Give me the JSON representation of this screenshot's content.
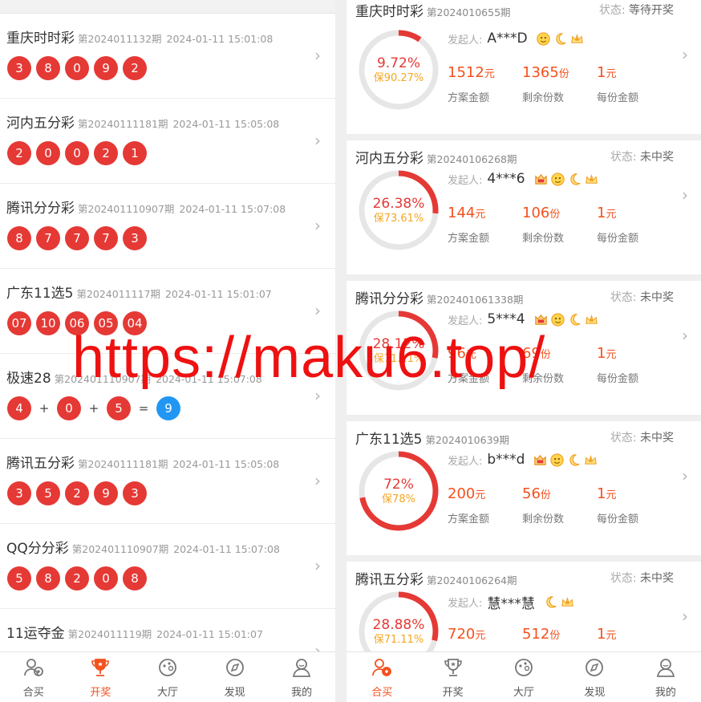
{
  "left": {
    "draws": [
      {
        "name": "重庆时时彩",
        "issue": "第2024011132期",
        "time": "2024-01-11 15:01:08",
        "balls": [
          "3",
          "8",
          "0",
          "9",
          "2"
        ]
      },
      {
        "name": "河内五分彩",
        "issue": "第20240111181期",
        "time": "2024-01-11 15:05:08",
        "balls": [
          "2",
          "0",
          "0",
          "2",
          "1"
        ]
      },
      {
        "name": "腾讯分分彩",
        "issue": "第202401110907期",
        "time": "2024-01-11 15:07:08",
        "balls": [
          "8",
          "7",
          "7",
          "7",
          "3"
        ]
      },
      {
        "name": "广东11选5",
        "issue": "第2024011117期",
        "time": "2024-01-11 15:01:07",
        "balls": [
          "07",
          "10",
          "06",
          "05",
          "04"
        ]
      },
      {
        "name": "极速28",
        "issue": "第202401110907期",
        "time": "2024-01-11 15:07:08",
        "sum": {
          "a": "4",
          "b": "0",
          "c": "5",
          "result": "9",
          "plus": "+",
          "equals": "="
        }
      },
      {
        "name": "腾讯五分彩",
        "issue": "第20240111181期",
        "time": "2024-01-11 15:05:08",
        "balls": [
          "3",
          "5",
          "2",
          "9",
          "3"
        ]
      },
      {
        "name": "QQ分分彩",
        "issue": "第202401110907期",
        "time": "2024-01-11 15:07:08",
        "balls": [
          "5",
          "8",
          "2",
          "0",
          "8"
        ]
      },
      {
        "name": "11运夺金",
        "issue": "第2024011119期",
        "time": "2024-01-11 15:01:07",
        "balls": []
      }
    ],
    "tabs": [
      {
        "label": "合买",
        "icon": "group-buy-icon",
        "active": false
      },
      {
        "label": "开奖",
        "icon": "trophy-icon",
        "active": true
      },
      {
        "label": "大厅",
        "icon": "game-hall-icon",
        "active": false
      },
      {
        "label": "发现",
        "icon": "compass-icon",
        "active": false
      },
      {
        "label": "我的",
        "icon": "profile-icon",
        "active": false
      }
    ]
  },
  "right": {
    "status_prefix": "状态:",
    "starter_label": "发起人:",
    "stat_labels": {
      "amount": "方案金额",
      "remaining": "剩余份数",
      "per_share": "每份金额"
    },
    "units": {
      "yuan": "元",
      "share": "份"
    },
    "plans": [
      {
        "name": "重庆时时彩",
        "issue": "第2024010655期",
        "status": "等待开奖",
        "progress": "9.72%",
        "progress_value": 0.0972,
        "keep": "保90.27%",
        "starter": "A***D",
        "badges": [
          "emoji-icon",
          "moon-icon",
          "crown-star-icon"
        ],
        "amount": "1512",
        "remaining": "1365",
        "per_share": "1"
      },
      {
        "name": "河内五分彩",
        "issue": "第20240106268期",
        "status": "未中奖",
        "progress": "26.38%",
        "progress_value": 0.2638,
        "keep": "保73.61%",
        "starter": "4***6",
        "badges": [
          "vip-icon",
          "emoji-icon",
          "moon-icon",
          "crown-star-icon"
        ],
        "amount": "144",
        "remaining": "106",
        "per_share": "1"
      },
      {
        "name": "腾讯分分彩",
        "issue": "第202401061338期",
        "status": "未中奖",
        "progress": "28.12%",
        "progress_value": 0.2812,
        "keep": "保71.11%",
        "starter": "5***4",
        "badges": [
          "vip-icon",
          "emoji-icon",
          "moon-icon",
          "crown-star-icon"
        ],
        "amount": "96",
        "remaining": "69",
        "per_share": "1"
      },
      {
        "name": "广东11选5",
        "issue": "第2024010639期",
        "status": "未中奖",
        "progress": "72%",
        "progress_value": 0.72,
        "keep": "保78%",
        "starter": "b***d",
        "badges": [
          "vip-icon",
          "emoji-icon",
          "moon-icon",
          "crown-star-icon"
        ],
        "amount": "200",
        "remaining": "56",
        "per_share": "1"
      },
      {
        "name": "腾讯五分彩",
        "issue": "第20240106264期",
        "status": "未中奖",
        "progress": "28.88%",
        "progress_value": 0.2888,
        "keep": "保71.11%",
        "starter": "慧***慧",
        "badges": [
          "moon-icon",
          "crown-star-icon"
        ],
        "amount": "720",
        "remaining": "512",
        "per_share": "1"
      }
    ],
    "tabs": [
      {
        "label": "合买",
        "icon": "group-buy-icon",
        "active": true
      },
      {
        "label": "开奖",
        "icon": "trophy-icon",
        "active": false
      },
      {
        "label": "大厅",
        "icon": "game-hall-icon",
        "active": false
      },
      {
        "label": "发现",
        "icon": "compass-icon",
        "active": false
      },
      {
        "label": "我的",
        "icon": "profile-icon",
        "active": false
      }
    ]
  },
  "overlay_url": "https://maku6.top/",
  "colors": {
    "ball_red": "#e53935",
    "ball_blue": "#2196f3",
    "accent_orange": "#f4511e",
    "keep_yellow": "#f5a623",
    "watermark_red": "#ee1111"
  }
}
